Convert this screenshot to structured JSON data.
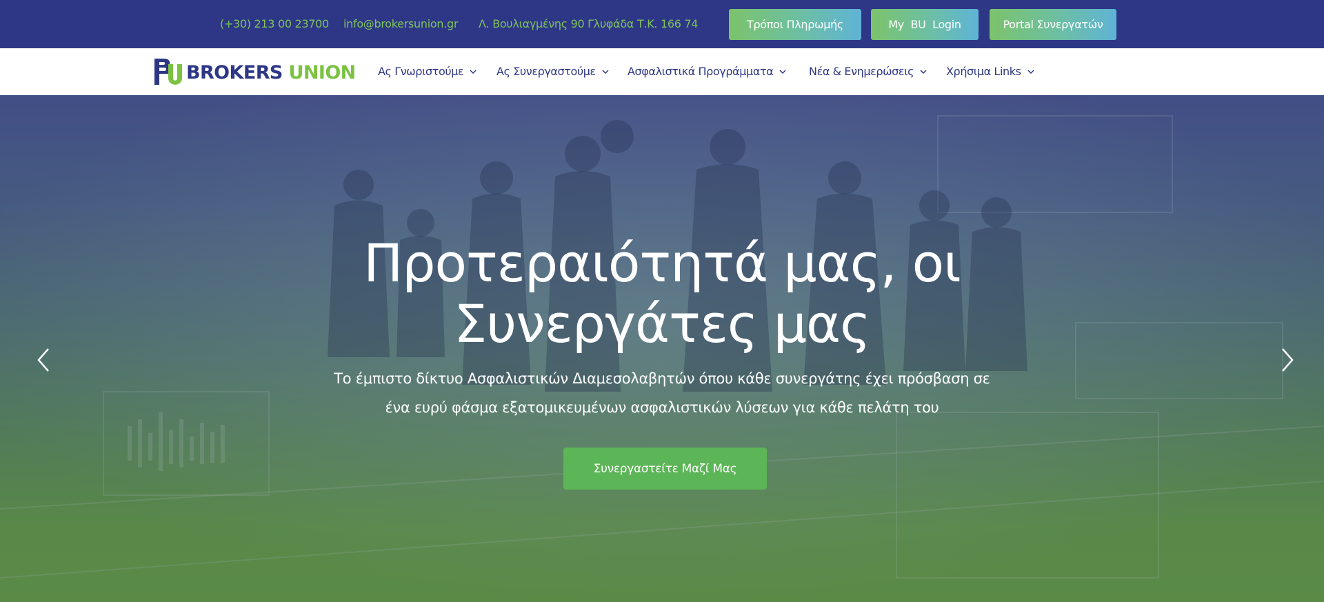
{
  "topbar": {
    "phone": "(+30) 213 00 23700",
    "email": "info@brokersunion.gr",
    "address": "Λ. Βουλιαγμένης 90 Γλυφάδα Τ.Κ. 166 74",
    "buttons": {
      "payment": "Τρόποι Πληρωμής",
      "login": "My  BU  Login",
      "portal": "Portal Συνεργατών"
    }
  },
  "logo": {
    "brokers": "BROKERS",
    "union": "UNION"
  },
  "nav": {
    "items": [
      {
        "label": "Ας Γνωριστούμε",
        "icon": "chevron-down-icon"
      },
      {
        "label": "Ας Συνεργαστούμε",
        "icon": "chevron-down-icon"
      },
      {
        "label": "Ασφαλιστικά Προγράμματα",
        "icon": "chevron-down-icon"
      },
      {
        "label": "Νέα & Ενημερώσεις",
        "icon": "chevron-down-icon"
      },
      {
        "label": "Χρήσιμα Links",
        "icon": "chevron-down-icon"
      }
    ]
  },
  "hero": {
    "title_line1": "Προτεραιότητά μας, οι",
    "title_line2": "Συνεργάτες μας",
    "subtitle_line1": "Το έμπιστο δίκτυο Ασφαλιστικών Διαμεσολαβητών όπου κάθε συνεργάτης έχει πρόσβαση σε",
    "subtitle_line2": "ένα ευρύ φάσμα εξατομικευμένων ασφαλιστικών λύσεων για κάθε πελάτη του",
    "cta": "Συνεργαστείτε Μαζί Μας",
    "prev_icon": "chevron-left-icon",
    "next_icon": "chevron-right-icon"
  },
  "colors": {
    "primary_navy": "#2d3786",
    "brand_green": "#7cc242",
    "cta_green": "#5cb556",
    "contact_green": "#7fc25b"
  }
}
